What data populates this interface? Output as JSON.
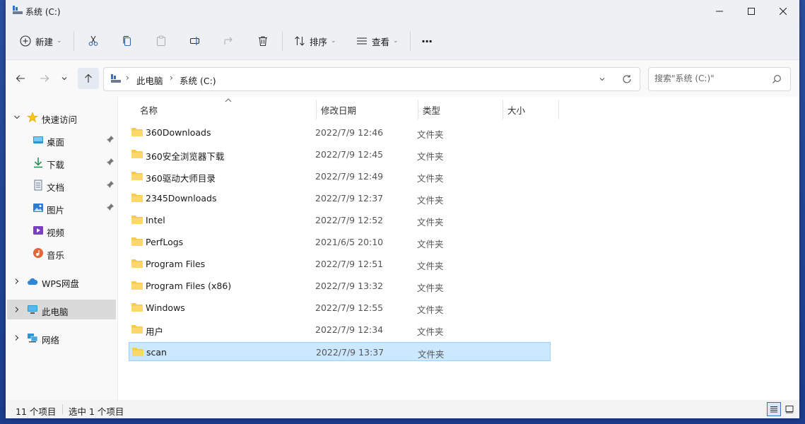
{
  "window": {
    "title": "系统 (C:)"
  },
  "toolbar": {
    "new_label": "新建",
    "sort_label": "排序",
    "view_label": "查看",
    "more_label": "···"
  },
  "address": {
    "path": [
      "此电脑",
      "系统 (C:)"
    ],
    "search_placeholder": "搜索\"系统 (C:)\""
  },
  "sidebar": {
    "quick_access": "快速访问",
    "quick_items": [
      {
        "label": "桌面",
        "icon": "desktop-icon",
        "pinned": true
      },
      {
        "label": "下载",
        "icon": "download-icon",
        "pinned": true
      },
      {
        "label": "文档",
        "icon": "document-icon",
        "pinned": true
      },
      {
        "label": "图片",
        "icon": "picture-icon",
        "pinned": true
      },
      {
        "label": "视频",
        "icon": "video-icon",
        "pinned": false
      },
      {
        "label": "音乐",
        "icon": "music-icon",
        "pinned": false
      }
    ],
    "wps": "WPS网盘",
    "thispc": "此电脑",
    "network": "网络"
  },
  "columns": {
    "name": "名称",
    "modified": "修改日期",
    "type": "类型",
    "size": "大小"
  },
  "files": [
    {
      "name": "360Downloads",
      "modified": "2022/7/9 12:46",
      "type": "文件夹"
    },
    {
      "name": "360安全浏览器下载",
      "modified": "2022/7/9 12:45",
      "type": "文件夹"
    },
    {
      "name": "360驱动大师目录",
      "modified": "2022/7/9 12:49",
      "type": "文件夹"
    },
    {
      "name": "2345Downloads",
      "modified": "2022/7/9 12:37",
      "type": "文件夹"
    },
    {
      "name": "Intel",
      "modified": "2022/7/9 12:52",
      "type": "文件夹"
    },
    {
      "name": "PerfLogs",
      "modified": "2021/6/5 20:10",
      "type": "文件夹"
    },
    {
      "name": "Program Files",
      "modified": "2022/7/9 12:51",
      "type": "文件夹"
    },
    {
      "name": "Program Files (x86)",
      "modified": "2022/7/9 13:32",
      "type": "文件夹"
    },
    {
      "name": "Windows",
      "modified": "2022/7/9 12:55",
      "type": "文件夹"
    },
    {
      "name": "用户",
      "modified": "2022/7/9 12:34",
      "type": "文件夹"
    },
    {
      "name": "scan",
      "modified": "2022/7/9 13:37",
      "type": "文件夹",
      "selected": true
    }
  ],
  "status": {
    "count": "11 个项目",
    "selected": "选中 1 个项目"
  },
  "colors": {
    "selection": "#cce8ff",
    "folder": "#f8c94a",
    "accent": "#3a6fc2"
  }
}
